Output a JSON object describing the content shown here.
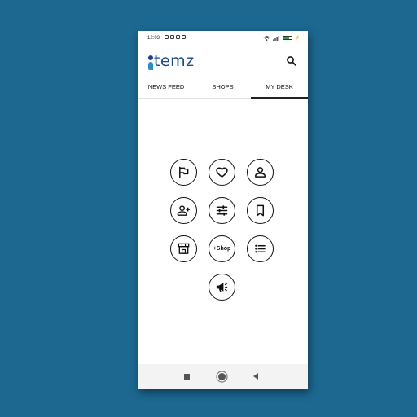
{
  "status_bar": {
    "time": "12:03",
    "battery_level": 0.7
  },
  "app": {
    "logo_text": "temz"
  },
  "tabs": [
    {
      "label": "NEWS FEED"
    },
    {
      "label": "SHOPS"
    },
    {
      "label": "MY DESK",
      "selected": true
    }
  ],
  "desk_buttons": [
    {
      "icon": "flag-icon"
    },
    {
      "icon": "heart-icon"
    },
    {
      "icon": "user-icon"
    },
    {
      "icon": "add-user-icon"
    },
    {
      "icon": "sliders-icon"
    },
    {
      "icon": "bookmark-icon"
    },
    {
      "icon": "store-icon"
    },
    {
      "label": "+Shop"
    },
    {
      "icon": "list-icon"
    },
    {
      "icon": "megaphone-icon"
    }
  ],
  "colors": {
    "background": "#1c6891",
    "logo_dark": "#1f3f8c",
    "logo_light": "#2a8fbf",
    "battery": "#2ea043"
  }
}
